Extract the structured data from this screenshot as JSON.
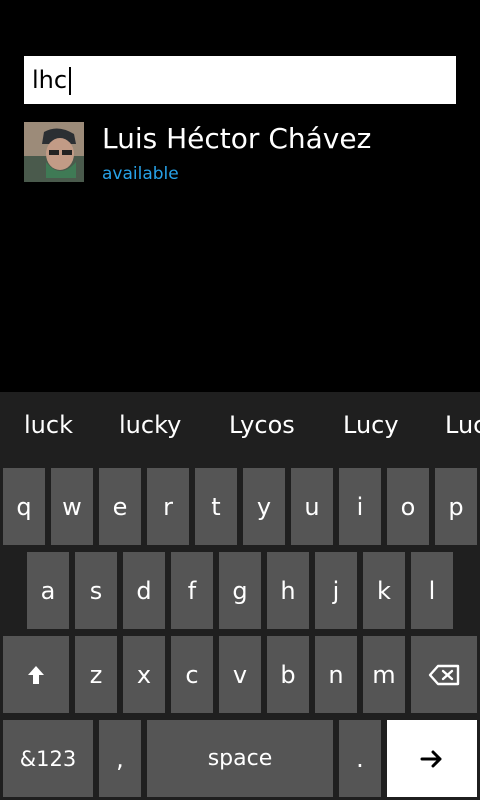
{
  "search": {
    "value": "lhc"
  },
  "result": {
    "name": "Luis Héctor Chávez",
    "status": "available",
    "avatar_icon": "profile-photo"
  },
  "keyboard": {
    "suggestions": [
      "luck",
      "lucky",
      "Lycos",
      "Lucy",
      "Luc"
    ],
    "row1": [
      "q",
      "w",
      "e",
      "r",
      "t",
      "y",
      "u",
      "i",
      "o",
      "p"
    ],
    "row2": [
      "a",
      "s",
      "d",
      "f",
      "g",
      "h",
      "j",
      "k",
      "l"
    ],
    "row3": [
      "z",
      "x",
      "c",
      "v",
      "b",
      "n",
      "m"
    ],
    "shift_icon": "shift-arrow-up",
    "backspace_icon": "backspace",
    "numbers_label": "&123",
    "comma_label": ",",
    "space_label": "space",
    "period_label": ".",
    "enter_icon": "arrow-right",
    "colors": {
      "key": "#555555",
      "background": "#1f1f1f",
      "accent": "#27a2e8"
    }
  }
}
